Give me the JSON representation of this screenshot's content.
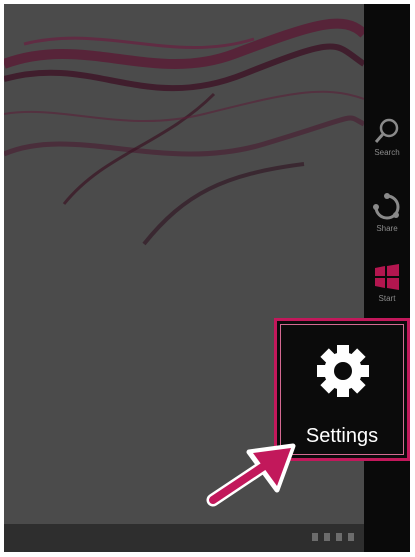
{
  "charms": [
    {
      "label": "Search",
      "icon": "search-icon"
    },
    {
      "label": "Share",
      "icon": "share-icon"
    },
    {
      "label": "Start",
      "icon": "windows-logo-icon"
    }
  ],
  "settings": {
    "label": "Settings",
    "icon": "gear-icon"
  },
  "colors": {
    "highlight": "#c2185b",
    "accent_arrow": "#c2185b",
    "charm_bar": "#0a0a0a"
  }
}
